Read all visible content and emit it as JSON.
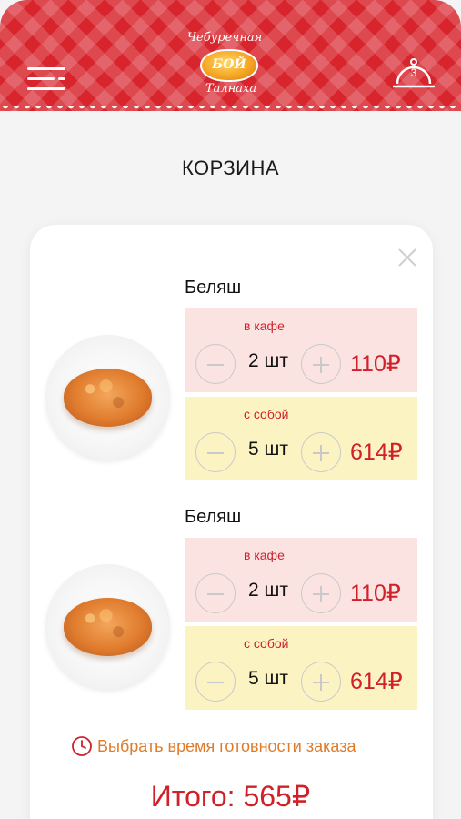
{
  "header": {
    "menu_icon": "hamburger-menu-icon",
    "logo": {
      "line1": "Чебуречная",
      "center": "БОЙ",
      "line2": "Талнаха"
    },
    "cart_icon": "cloche-icon",
    "cart_count": "3",
    "brand_color": "#d8252d"
  },
  "page": {
    "title": "КОРЗИНА",
    "close_icon": "close-icon"
  },
  "cart_items": [
    {
      "name": "Беляш",
      "options": [
        {
          "label": "в кафе",
          "qty": "2 шт",
          "price": "110₽"
        },
        {
          "label": "с собой",
          "qty": "5 шт",
          "price": "614₽"
        }
      ]
    },
    {
      "name": "Беляш",
      "options": [
        {
          "label": "в кафе",
          "qty": "2 шт",
          "price": "110₽"
        },
        {
          "label": "с собой",
          "qty": "5 шт",
          "price": "614₽"
        }
      ]
    }
  ],
  "footer": {
    "clock_icon": "clock-icon",
    "time_link": "Выбрать время готовности заказа",
    "total": "Итого: 565₽"
  },
  "colors": {
    "accent": "#d0202a",
    "cafe_bg": "#fbe3e2",
    "togo_bg": "#fcf3c3",
    "link": "#e07b28"
  }
}
